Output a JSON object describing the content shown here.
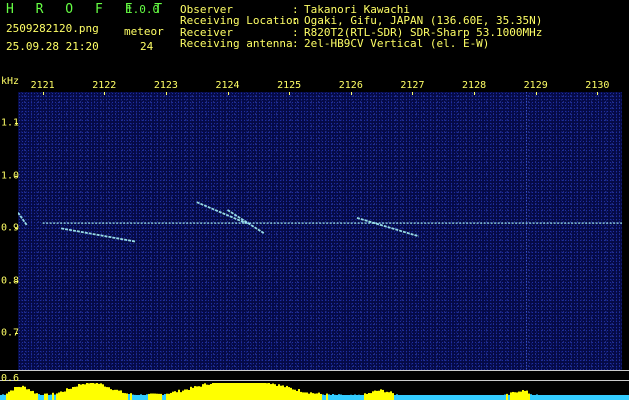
{
  "header": {
    "app_title": "H R O F F T",
    "app_version": "1.0.0",
    "file_name": "2509282120.png",
    "datetime": "25.09.28 21:20",
    "meteor_label": "meteor",
    "meteor_count": "24",
    "info": [
      {
        "key": "Observer",
        "value": "Takanori Kawachi"
      },
      {
        "key": "Receiving Location",
        "value": "Ogaki, Gifu, JAPAN (136.60E, 35.35N)"
      },
      {
        "key": "Receiver",
        "value": "R820T2(RTL-SDR) SDR-Sharp 53.1000MHz"
      },
      {
        "key": "Receiving antenna",
        "value": "2el-HB9CV Vertical (el. E-W)"
      }
    ]
  },
  "colors": {
    "background": "#050a46",
    "text": "#ffff66",
    "title": "#66ff44",
    "signal": "#b0ffff",
    "meter": "#ffff00",
    "meter_base": "#33ccff"
  },
  "chart_data": {
    "type": "heatmap",
    "y_unit": "kHz",
    "x_ticks": [
      "2121",
      "2122",
      "2123",
      "2124",
      "2125",
      "2126",
      "2127",
      "2128",
      "2129",
      "2130"
    ],
    "y_ticks": [
      "1.1",
      "1.0",
      "0.9",
      "0.8",
      "0.7",
      "0.6"
    ],
    "x_range": [
      2120.6,
      2130.4
    ],
    "y_range": [
      0.63,
      1.16
    ],
    "bottom_label": "0.6",
    "carrier_freq_khz": 0.91,
    "meteor_traces": [
      {
        "x": [
          2124.0,
          2124.6
        ],
        "y": [
          0.935,
          0.89
        ]
      },
      {
        "x": [
          2120.6,
          2120.75
        ],
        "y": [
          0.93,
          0.905
        ]
      },
      {
        "x": [
          2121.3,
          2122.5
        ],
        "y": [
          0.9,
          0.875
        ]
      },
      {
        "x": [
          2126.1,
          2127.1
        ],
        "y": [
          0.92,
          0.885
        ]
      },
      {
        "x": [
          2123.5,
          2124.3
        ],
        "y": [
          0.95,
          0.91
        ]
      }
    ]
  }
}
